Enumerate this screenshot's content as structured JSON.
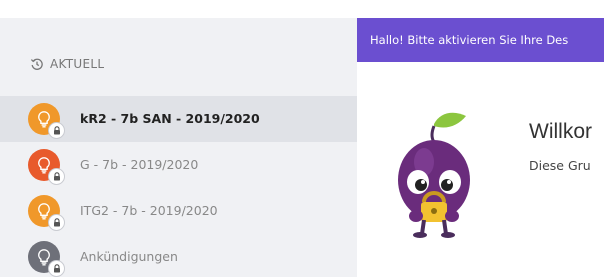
{
  "sidebar": {
    "section_title": "AKTUELL",
    "items": [
      {
        "label": "kR2 - 7b SAN - 2019/2020",
        "color": "#f0982a",
        "active": true
      },
      {
        "label": "G - 7b - 2019/2020",
        "color": "#e85a2c",
        "active": false
      },
      {
        "label": "ITG2 - 7b - 2019/2020",
        "color": "#f0982a",
        "active": false
      },
      {
        "label": "Ankündigungen",
        "color": "#6e7079",
        "active": false
      }
    ]
  },
  "banner": {
    "text": "Hallo! Bitte aktivieren Sie Ihre Des",
    "color": "#6b4fd0"
  },
  "main": {
    "welcome_title": "Willkor",
    "welcome_text": "Diese Gru"
  },
  "icons": {
    "section": "history-icon",
    "group": "lightbulb-icon",
    "badge": "lock-icon"
  }
}
